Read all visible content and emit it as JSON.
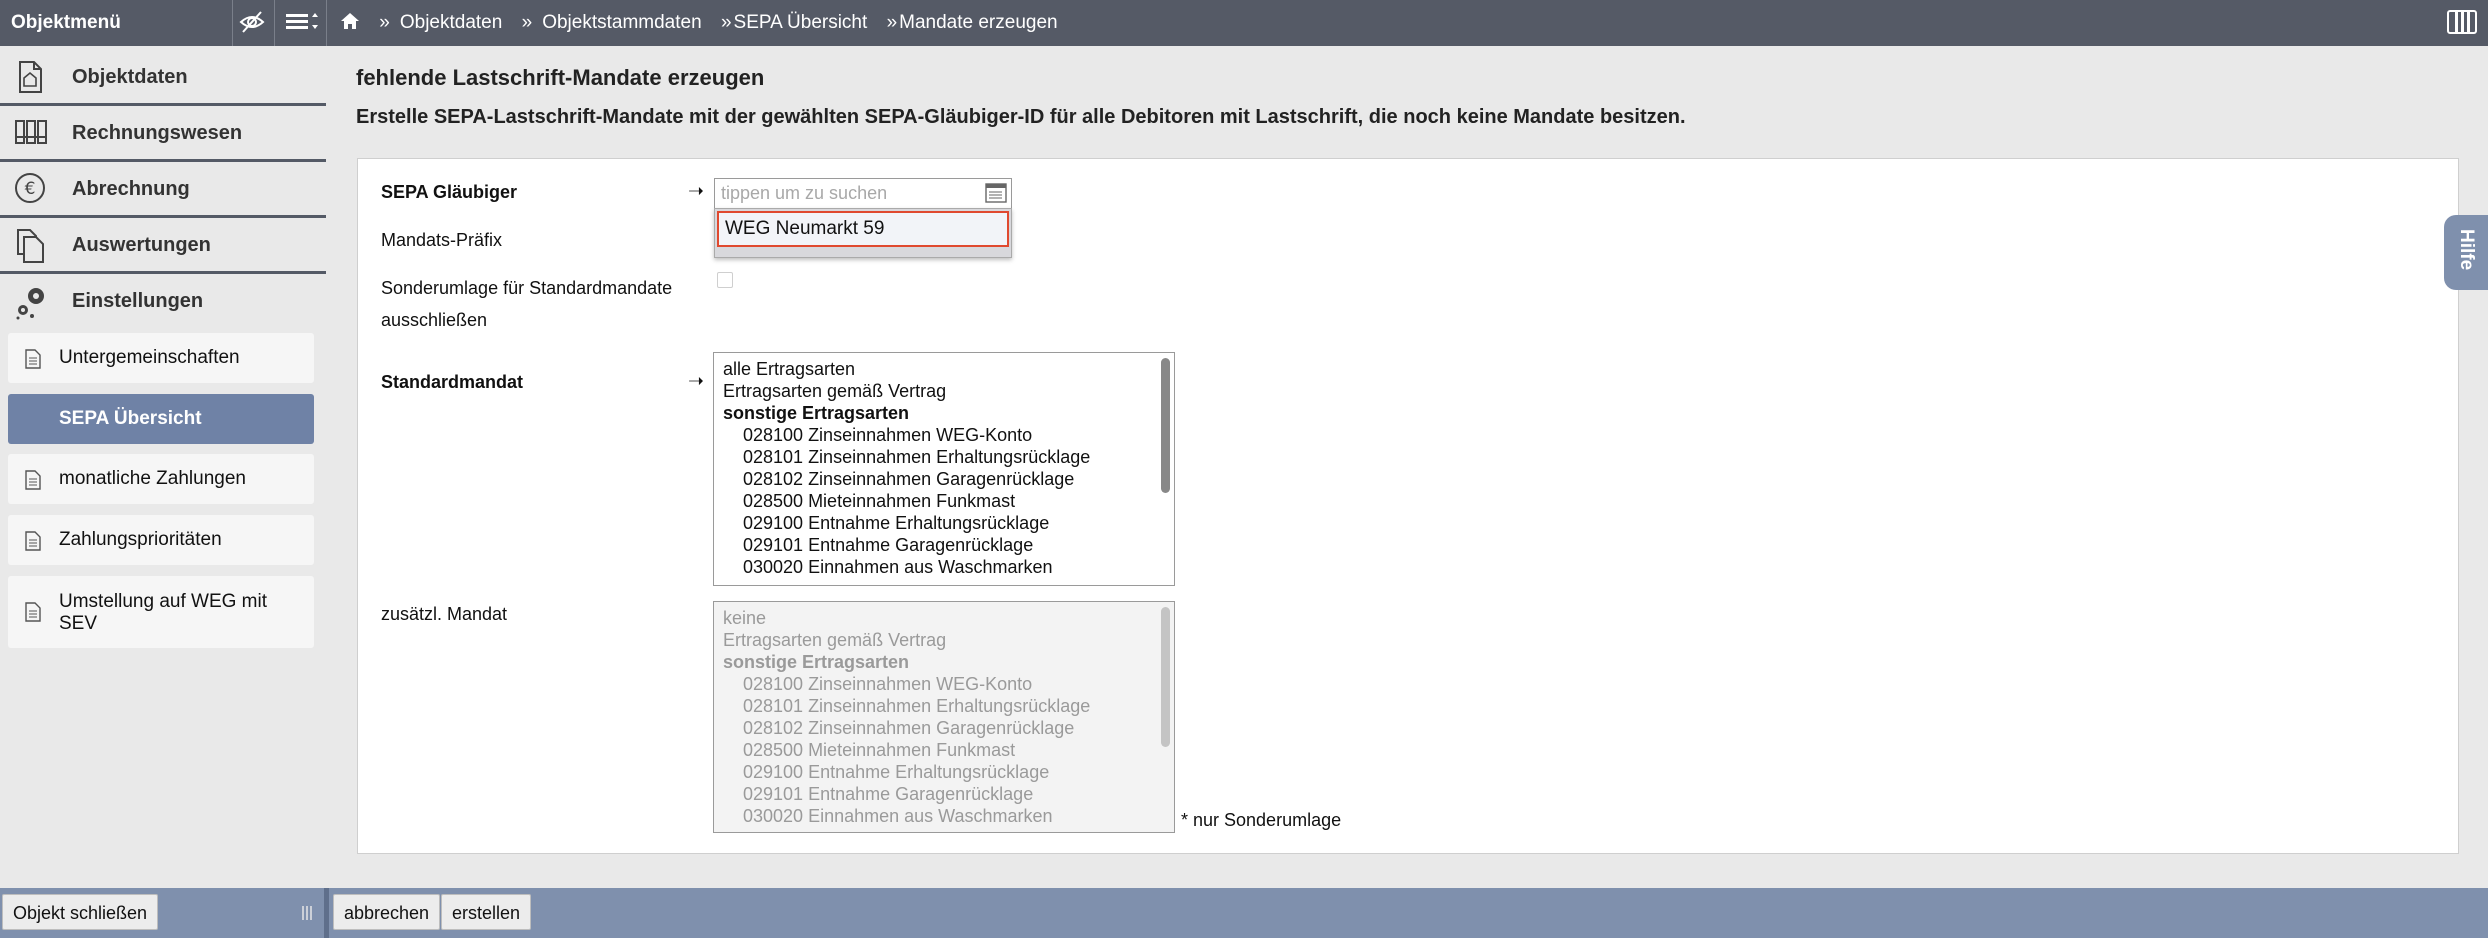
{
  "topbar": {
    "menu_title": "Objektmenü",
    "breadcrumb": [
      "Objektdaten",
      "Objektstammdaten",
      "SEPA Übersicht",
      "Mandate erzeugen"
    ],
    "separator": "»"
  },
  "sidebar": {
    "sections": [
      {
        "label": "Objektdaten",
        "icon": "document-icon"
      },
      {
        "label": "Rechnungswesen",
        "icon": "binders-icon"
      },
      {
        "label": "Abrechnung",
        "icon": "euro-icon"
      },
      {
        "label": "Auswertungen",
        "icon": "documents-icon"
      },
      {
        "label": "Einstellungen",
        "icon": "gears-icon"
      }
    ],
    "items": [
      {
        "label": "Untergemeinschaften"
      },
      {
        "label": "SEPA Übersicht",
        "active": true
      },
      {
        "label": "monatliche Zahlungen"
      },
      {
        "label": "Zahlungsprioritäten"
      },
      {
        "label": "Umstellung auf WEG mit SEV"
      }
    ]
  },
  "main": {
    "title": "fehlende Lastschrift-Mandate erzeugen",
    "subtitle": "Erstelle SEPA-Lastschrift-Mandate mit der gewählten SEPA-Gläubiger-ID für alle Debitoren mit Lastschrift, die noch keine Mandate besitzen.",
    "form": {
      "glaeubiger_label": "SEPA Gläubiger",
      "glaeubiger_placeholder": "tippen um zu suchen",
      "glaeubiger_option": "WEG Neumarkt 59",
      "praefix_label": "Mandats-Präfix",
      "sonderumlage_label_1": "Sonderumlage für Standardmandate",
      "sonderumlage_label_2": "ausschließen",
      "sonderumlage_checked": false,
      "standardmandat_label": "Standardmandat",
      "zusaetzl_label": "zusätzl. Mandat",
      "arrow": "➝",
      "note": "* nur Sonderumlage"
    },
    "standard_list": [
      {
        "text": "alle Ertragsarten",
        "type": "item"
      },
      {
        "text": "Ertragsarten gemäß Vertrag",
        "type": "item"
      },
      {
        "text": "sonstige Ertragsarten",
        "type": "group"
      },
      {
        "text": "028100 Zinseinnahmen WEG-Konto",
        "type": "indent"
      },
      {
        "text": "028101 Zinseinnahmen Erhaltungsrücklage",
        "type": "indent"
      },
      {
        "text": "028102 Zinseinnahmen Garagenrücklage",
        "type": "indent"
      },
      {
        "text": "028500 Mieteinnahmen Funkmast",
        "type": "indent"
      },
      {
        "text": "029100 Entnahme Erhaltungsrücklage",
        "type": "indent"
      },
      {
        "text": "029101 Entnahme Garagenrücklage",
        "type": "indent"
      },
      {
        "text": "030020 Einnahmen aus Waschmarken",
        "type": "indent"
      }
    ],
    "zusaetzl_list": [
      {
        "text": "keine",
        "type": "item"
      },
      {
        "text": "Ertragsarten gemäß Vertrag",
        "type": "item"
      },
      {
        "text": "sonstige Ertragsarten",
        "type": "group"
      },
      {
        "text": "028100 Zinseinnahmen WEG-Konto",
        "type": "indent"
      },
      {
        "text": "028101 Zinseinnahmen Erhaltungsrücklage",
        "type": "indent"
      },
      {
        "text": "028102 Zinseinnahmen Garagenrücklage",
        "type": "indent"
      },
      {
        "text": "028500 Mieteinnahmen Funkmast",
        "type": "indent"
      },
      {
        "text": "029100 Entnahme Erhaltungsrücklage",
        "type": "indent"
      },
      {
        "text": "029101 Entnahme Garagenrücklage",
        "type": "indent"
      },
      {
        "text": "030020 Einnahmen aus Waschmarken",
        "type": "indent"
      }
    ]
  },
  "help_tab": "Hilfe",
  "bottombar": {
    "close_label": "Objekt schließen",
    "cancel_label": "abbrechen",
    "create_label": "erstellen"
  },
  "colors": {
    "topbar": "#555a66",
    "accent": "#7f90ad",
    "active_item": "#6f82a6",
    "highlight_border": "#e0492f"
  }
}
